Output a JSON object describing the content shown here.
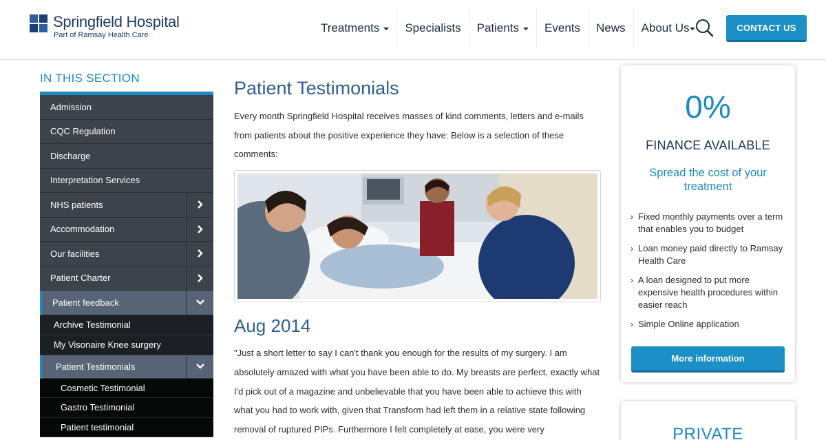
{
  "brand": {
    "name": "Springfield Hospital",
    "tagline": "Part of Ramsay Health Care"
  },
  "nav": {
    "items": [
      {
        "label": "Treatments",
        "has_dropdown": true
      },
      {
        "label": "Specialists",
        "has_dropdown": false
      },
      {
        "label": "Patients",
        "has_dropdown": true
      },
      {
        "label": "Events",
        "has_dropdown": false
      },
      {
        "label": "News",
        "has_dropdown": false
      },
      {
        "label": "About Us",
        "has_dropdown": true
      }
    ],
    "search_icon": "search-icon",
    "contact_label": "CONTACT US"
  },
  "sidebar": {
    "section_title": "IN THIS SECTION",
    "items": [
      {
        "label": "Admission",
        "expandable": false
      },
      {
        "label": "CQC Regulation",
        "expandable": false
      },
      {
        "label": "Discharge",
        "expandable": false
      },
      {
        "label": "Interpretation Services",
        "expandable": false
      },
      {
        "label": "NHS patients",
        "expandable": true
      },
      {
        "label": "Accommodation",
        "expandable": true
      },
      {
        "label": "Our facilities",
        "expandable": true
      },
      {
        "label": "Patient Charter",
        "expandable": true
      },
      {
        "label": "Patient feedback",
        "expandable": true,
        "expanded": true
      }
    ],
    "feedback_children": [
      {
        "label": "Archive Testimonial"
      },
      {
        "label": "My Visonaire Knee surgery"
      },
      {
        "label": "Patient Testimonials",
        "expanded": true
      }
    ],
    "testimonial_children": [
      {
        "label": "Cosmetic Testimonial"
      },
      {
        "label": "Gastro Testimonial"
      },
      {
        "label": "Patient testimonial"
      }
    ]
  },
  "main": {
    "title": "Patient Testimonials",
    "intro": "Every month Springfield Hospital receives masses of kind comments, letters and e-mails from patients about the positive experience they have: Below is a selection of these comments:",
    "subheading": "Aug 2014",
    "quote": "\"Just a short letter to say I can't thank you enough for the results of my surgery. I am absolutely amazed with what you have been able to do. My breasts are perfect, exactly what I'd pick out of a magazine and unbelievable that you have been able to achieve this with what you had to work with, given that Transform had left them in a relative state following removal of ruptured PIPs. Furthermore I felt completely at ease, you were very"
  },
  "widget": {
    "big": "0%",
    "heading": "FINANCE AVAILABLE",
    "subheading": "Spread the cost of your treatment",
    "bullets": [
      "Fixed monthly payments over a term that enables you to budget",
      "Loan money paid directly to Ramsay Health Care",
      "A loan designed to put more expensive health procedures within easier reach",
      "Simple Online application"
    ],
    "button": "More information"
  },
  "widget2": {
    "heading": "PRIVATE"
  },
  "colors": {
    "accent": "#1a8ac4",
    "navy": "#1f3a66",
    "sidebar_bg": "#3d434a",
    "sidebar_active": "#566475"
  }
}
